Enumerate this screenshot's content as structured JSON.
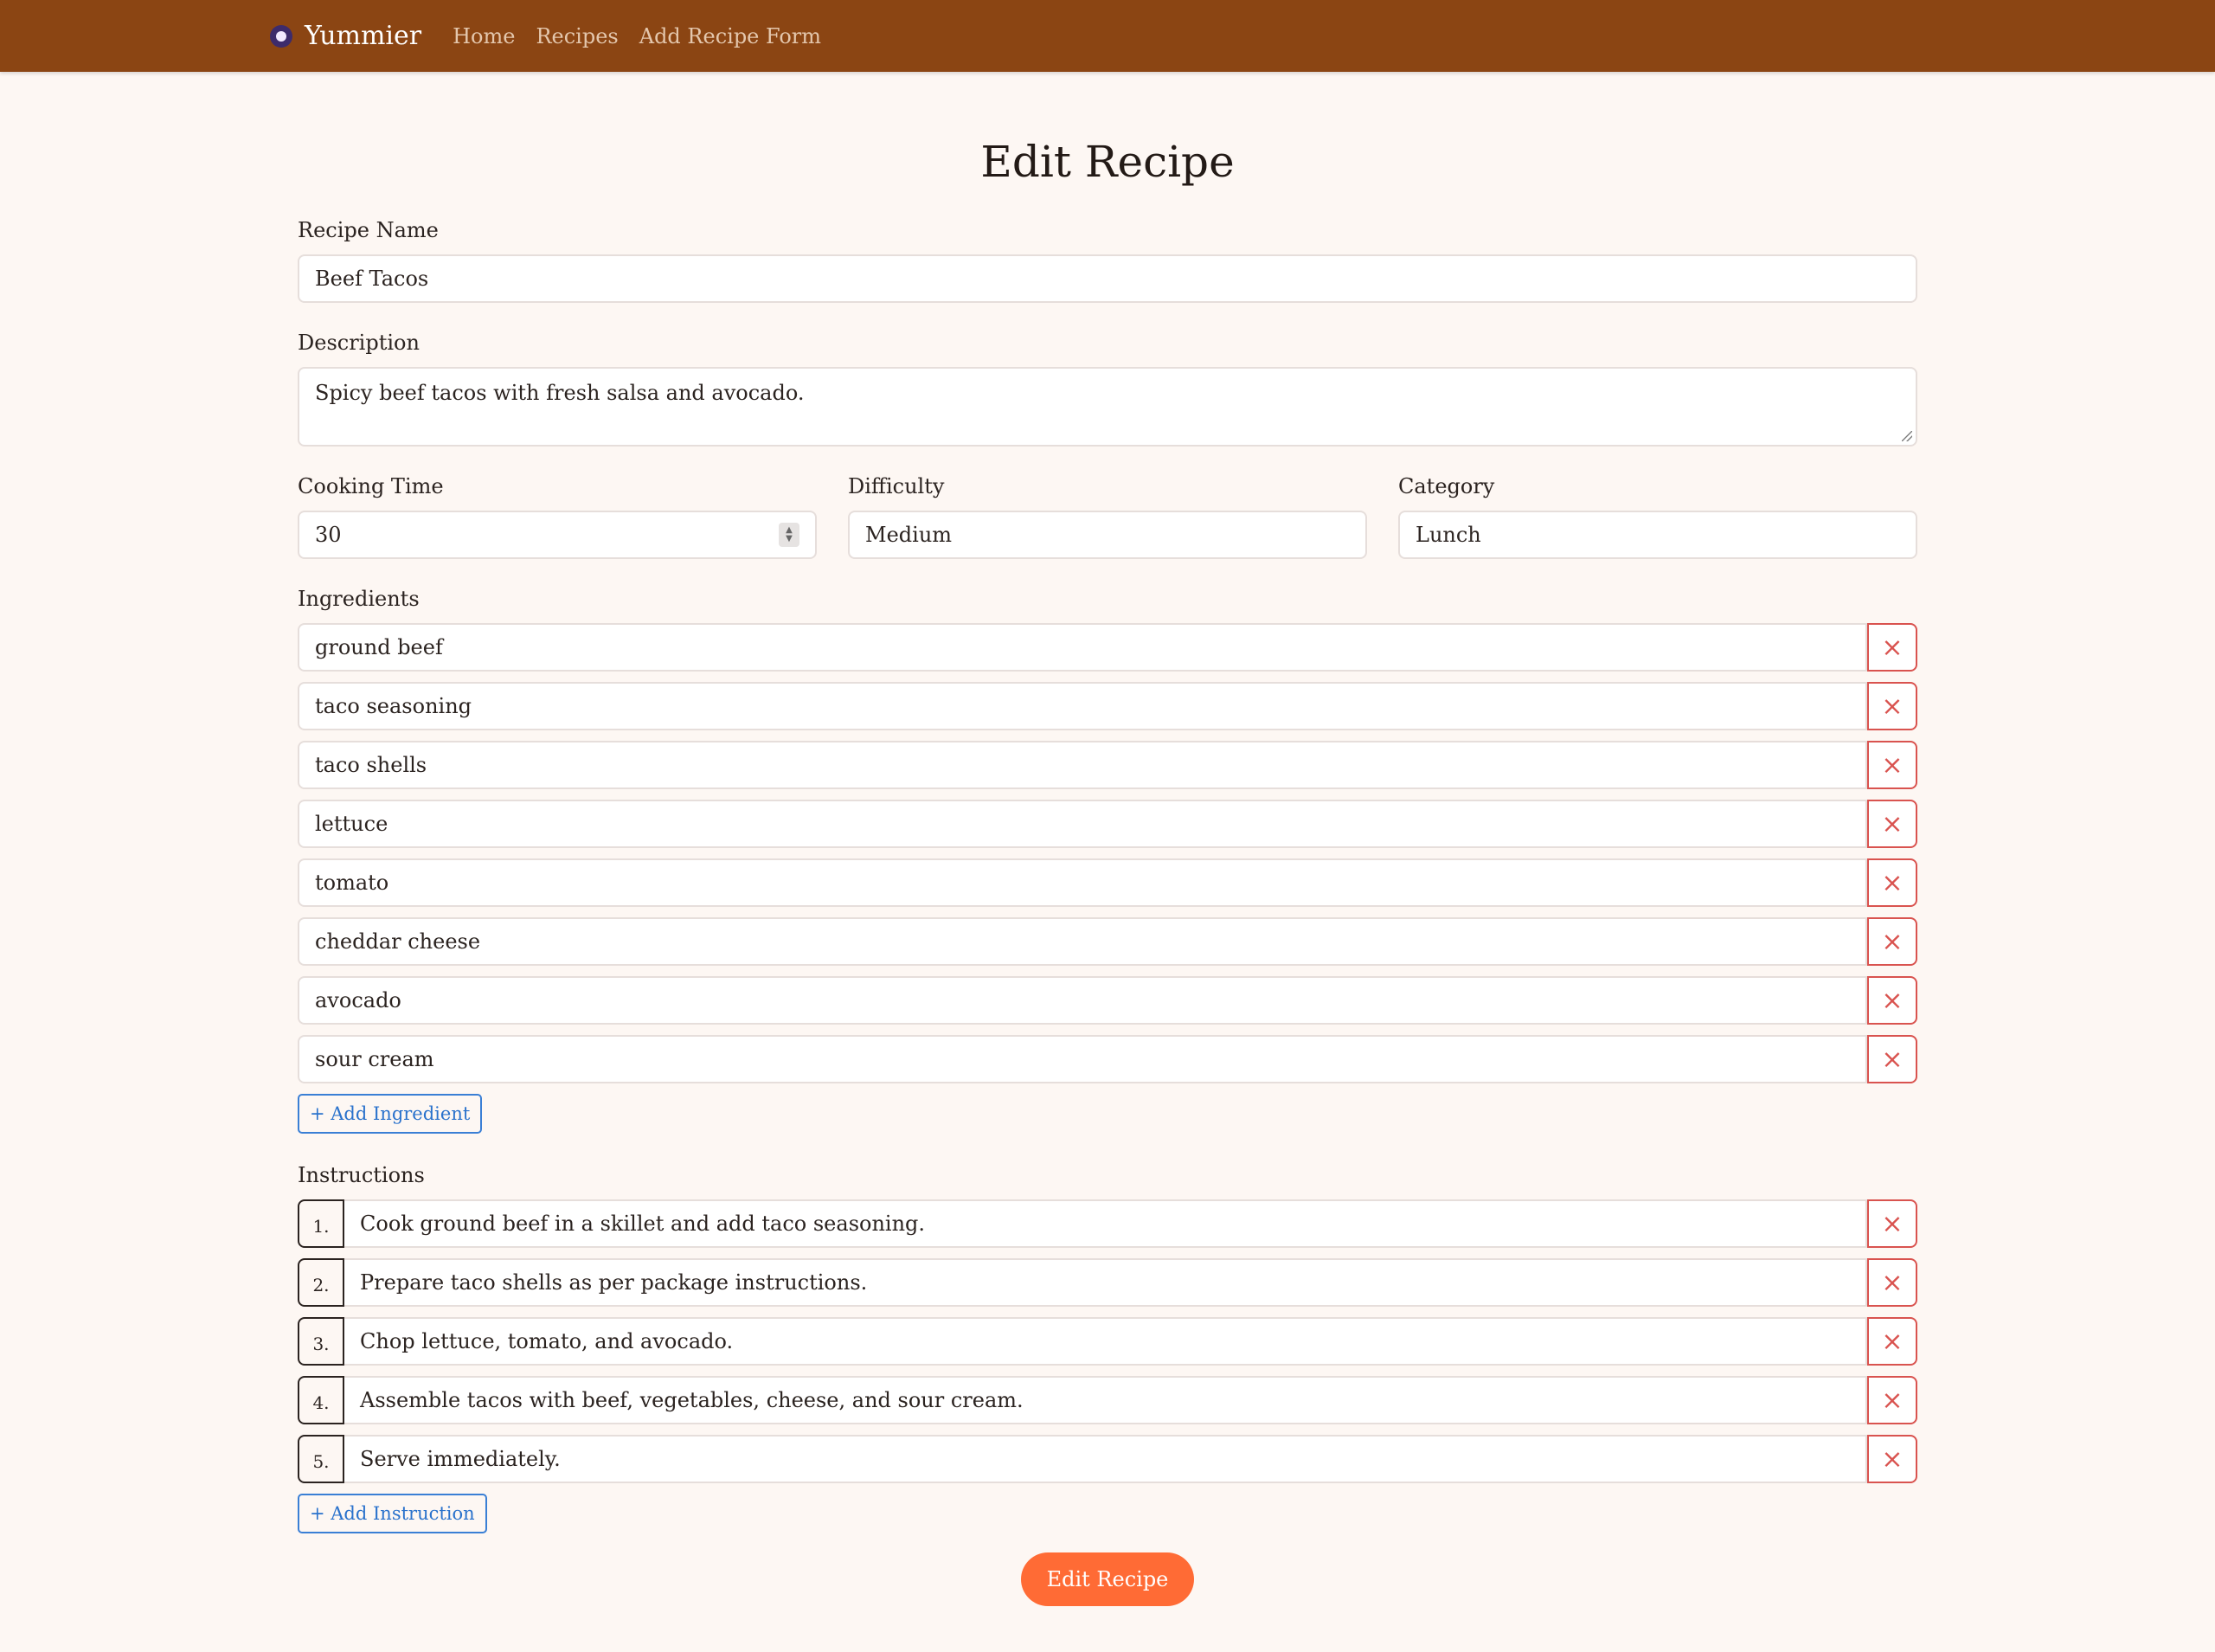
{
  "nav": {
    "brand": "Yummier",
    "links": [
      "Home",
      "Recipes",
      "Add Recipe Form"
    ]
  },
  "page_title": "Edit Recipe",
  "form": {
    "name_label": "Recipe Name",
    "name_value": "Beef Tacos",
    "description_label": "Description",
    "description_value": "Spicy beef tacos with fresh salsa and avocado.",
    "cooking_time_label": "Cooking Time",
    "cooking_time_value": "30",
    "difficulty_label": "Difficulty",
    "difficulty_value": "Medium",
    "category_label": "Category",
    "category_value": "Lunch",
    "ingredients_label": "Ingredients",
    "ingredients": [
      "ground beef",
      "taco seasoning",
      "taco shells",
      "lettuce",
      "tomato",
      "cheddar cheese",
      "avocado",
      "sour cream"
    ],
    "add_ingredient_label": "+ Add Ingredient",
    "instructions_label": "Instructions",
    "instructions": [
      {
        "num": "1.",
        "text": "Cook ground beef in a skillet and add taco seasoning."
      },
      {
        "num": "2.",
        "text": "Prepare taco shells as per package instructions."
      },
      {
        "num": "3.",
        "text": "Chop lettuce, tomato, and avocado."
      },
      {
        "num": "4.",
        "text": "Assemble tacos with beef, vegetables, cheese, and sour cream."
      },
      {
        "num": "5.",
        "text": "Serve immediately."
      }
    ],
    "add_instruction_label": "+ Add Instruction",
    "remove_icon": "×",
    "submit_label": "Edit Recipe"
  },
  "colors": {
    "navbar": "#8b4513",
    "background": "#fdf7f3",
    "remove": "#d9534f",
    "add": "#3a7fd5",
    "submit": "#ff6b35"
  }
}
